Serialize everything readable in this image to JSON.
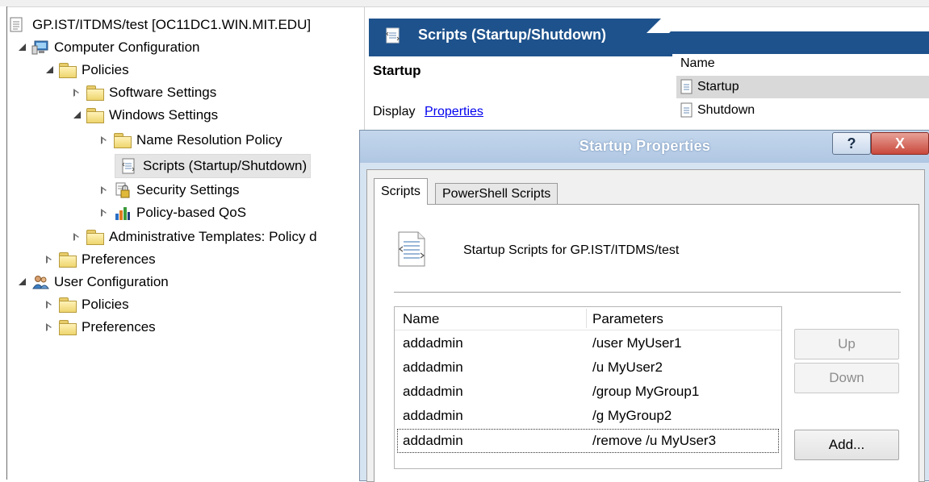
{
  "tree": {
    "root": "GP.IST/ITDMS/test [OC11DC1.WIN.MIT.EDU]",
    "computer_configuration": "Computer Configuration",
    "policies": "Policies",
    "software_settings": "Software Settings",
    "windows_settings": "Windows Settings",
    "name_resolution_policy": "Name Resolution Policy",
    "scripts": "Scripts (Startup/Shutdown)",
    "security_settings": "Security Settings",
    "policy_qos": "Policy-based QoS",
    "admin_templates": "Administrative Templates: Policy d",
    "preferences": "Preferences",
    "user_configuration": "User Configuration",
    "user_policies": "Policies",
    "user_preferences": "Preferences"
  },
  "details": {
    "header_title": "Scripts (Startup/Shutdown)",
    "section_title": "Startup",
    "display_prefix": "Display",
    "properties_link": "Properties",
    "name_column": "Name",
    "items": [
      "Startup",
      "Shutdown"
    ]
  },
  "dialog": {
    "title": "Startup Properties",
    "help_button": "?",
    "close_button": "X",
    "tabs": [
      "Scripts",
      "PowerShell Scripts"
    ],
    "description": "Startup Scripts for GP.IST/ITDMS/test",
    "columns": [
      "Name",
      "Parameters"
    ],
    "rows": [
      {
        "name": "addadmin",
        "params": "/user MyUser1"
      },
      {
        "name": "addadmin",
        "params": "/u MyUser2"
      },
      {
        "name": "addadmin",
        "params": "/group MyGroup1"
      },
      {
        "name": "addadmin",
        "params": "/g MyGroup2"
      },
      {
        "name": "addadmin",
        "params": "/remove /u MyUser3"
      }
    ],
    "buttons": {
      "up": "Up",
      "down": "Down",
      "add": "Add..."
    }
  },
  "colors": {
    "header_blue": "#1e528c",
    "dialog_frame": "#b0c7e3",
    "close_red": "#c9483c",
    "link_blue": "#0000ee"
  }
}
